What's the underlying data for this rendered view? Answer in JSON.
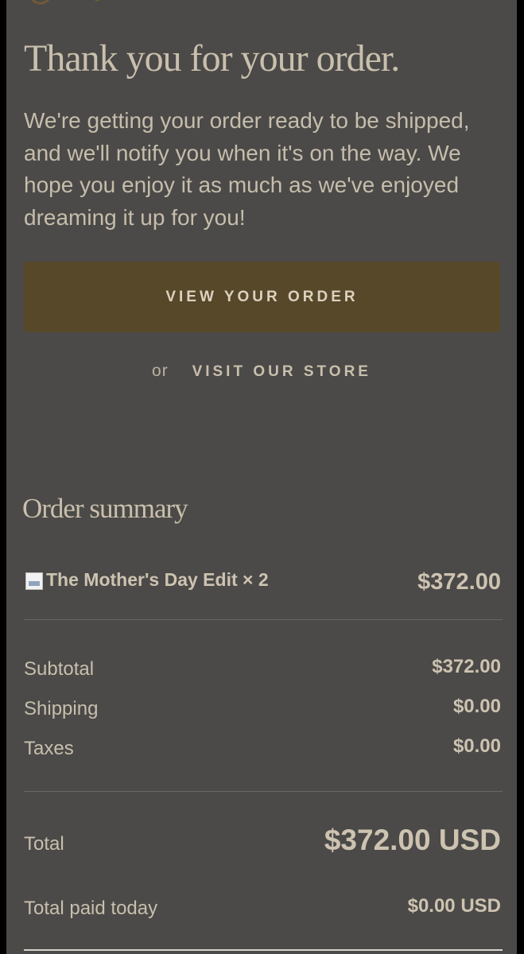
{
  "header": {
    "title": "Thank you for your order.",
    "message": "We're getting your order ready to be shipped, and we'll notify you when it's on the way. We hope you enjoy it as much as we've enjoyed dreaming it up for you!"
  },
  "actions": {
    "view_order_label": "VIEW YOUR ORDER",
    "or_text": "or",
    "visit_store_label": "VISIT OUR STORE"
  },
  "summary": {
    "heading": "Order summary",
    "items": [
      {
        "name": "The Mother's Day Edit × 2",
        "price": "$372.00",
        "icon": "product-thumbnail-icon"
      }
    ],
    "lines": {
      "subtotal": {
        "label": "Subtotal",
        "value": "$372.00"
      },
      "shipping": {
        "label": "Shipping",
        "value": "$0.00"
      },
      "taxes": {
        "label": "Taxes",
        "value": "$0.00"
      }
    },
    "total": {
      "label": "Total",
      "value": "$372.00 USD"
    },
    "paid_today": {
      "label": "Total paid today",
      "value": "$0.00 USD"
    }
  },
  "colors": {
    "background": "#4b4a48",
    "button": "#57482a",
    "text": "#c8bfae"
  }
}
